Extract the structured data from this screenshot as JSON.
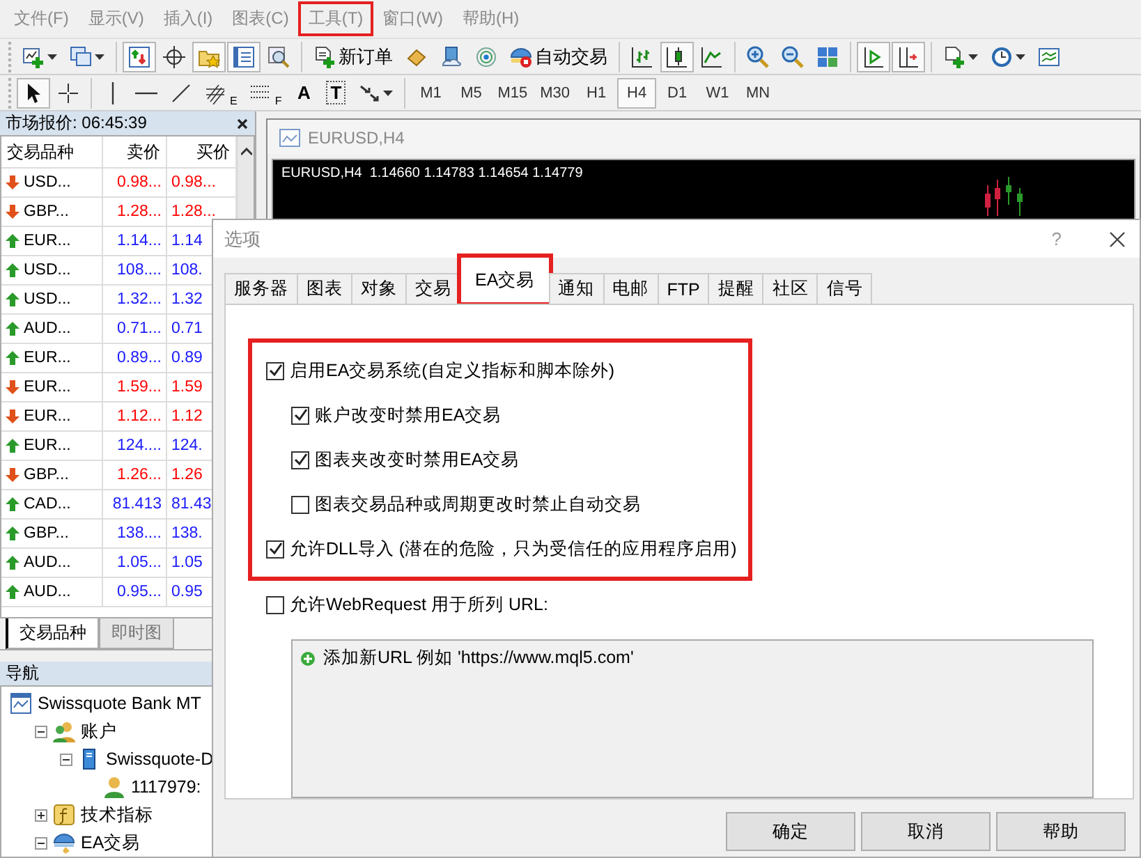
{
  "menu": [
    {
      "label": "文件(F)",
      "highlighted": false
    },
    {
      "label": "显示(V)",
      "highlighted": false
    },
    {
      "label": "插入(I)",
      "highlighted": false
    },
    {
      "label": "图表(C)",
      "highlighted": false
    },
    {
      "label": "工具(T)",
      "highlighted": true
    },
    {
      "label": "窗口(W)",
      "highlighted": false
    },
    {
      "label": "帮助(H)",
      "highlighted": false
    }
  ],
  "toolbar_main": [
    {
      "buttons": [
        {
          "kind": "newchart",
          "pressed": false,
          "dropdown": true
        },
        {
          "kind": "profiles",
          "pressed": false,
          "dropdown": true
        }
      ]
    },
    {
      "buttons": [
        {
          "kind": "marketwatch",
          "pressed": true
        },
        {
          "kind": "datawindow",
          "pressed": false
        },
        {
          "kind": "favorites",
          "pressed": true
        },
        {
          "kind": "navigator",
          "pressed": true
        },
        {
          "kind": "tester",
          "pressed": false
        }
      ]
    },
    {
      "buttons": [
        {
          "kind": "neworder",
          "pressed": false,
          "label": "新订单"
        },
        {
          "kind": "editor",
          "pressed": false
        },
        {
          "kind": "cloud",
          "pressed": false
        },
        {
          "kind": "signals",
          "pressed": false
        },
        {
          "kind": "autotrade",
          "pressed": false,
          "label": "自动交易"
        }
      ]
    },
    {
      "buttons": [
        {
          "kind": "bars",
          "pressed": false
        },
        {
          "kind": "candles",
          "pressed": true
        },
        {
          "kind": "line",
          "pressed": false
        }
      ]
    },
    {
      "buttons": [
        {
          "kind": "zoomin",
          "pressed": false
        },
        {
          "kind": "zoomout",
          "pressed": false
        },
        {
          "kind": "tile",
          "pressed": false
        }
      ]
    },
    {
      "buttons": [
        {
          "kind": "autoscroll",
          "pressed": true
        },
        {
          "kind": "shift",
          "pressed": true
        }
      ]
    },
    {
      "buttons": [
        {
          "kind": "template",
          "pressed": false,
          "dropdown": true
        },
        {
          "kind": "clock",
          "pressed": false,
          "dropdown": true
        },
        {
          "kind": "indicator",
          "pressed": false
        }
      ]
    }
  ],
  "toolbar_tools": [
    {
      "buttons": [
        {
          "kind": "cursor",
          "pressed": true
        },
        {
          "kind": "cross",
          "pressed": false
        }
      ]
    },
    {
      "buttons": [
        {
          "kind": "vline",
          "pressed": false
        },
        {
          "kind": "hline",
          "pressed": false
        },
        {
          "kind": "trend",
          "pressed": false
        },
        {
          "kind": "fibchannel",
          "pressed": false,
          "sub": "E"
        },
        {
          "kind": "fib",
          "pressed": false,
          "sub": "F"
        },
        {
          "kind": "text",
          "pressed": false,
          "label": "A"
        },
        {
          "kind": "textlabel",
          "pressed": false,
          "label": "T"
        },
        {
          "kind": "arrows",
          "pressed": false,
          "dropdown": true
        }
      ]
    },
    {
      "buttons": [
        {
          "kind": "period",
          "label": "M1",
          "pressed": false
        },
        {
          "kind": "period",
          "label": "M5",
          "pressed": false
        },
        {
          "kind": "period",
          "label": "M15",
          "pressed": false
        },
        {
          "kind": "period",
          "label": "M30",
          "pressed": false
        },
        {
          "kind": "period",
          "label": "H1",
          "pressed": false
        },
        {
          "kind": "period",
          "label": "H4",
          "pressed": true
        },
        {
          "kind": "period",
          "label": "D1",
          "pressed": false
        },
        {
          "kind": "period",
          "label": "W1",
          "pressed": false
        },
        {
          "kind": "period",
          "label": "MN",
          "pressed": false
        }
      ]
    }
  ],
  "market_watch": {
    "title": "市场报价: 06:45:39",
    "columns": [
      "交易品种",
      "卖价",
      "买价"
    ],
    "rows": [
      {
        "symbol": "USD...",
        "bid": "0.98...",
        "ask": "0.98...",
        "up": false
      },
      {
        "symbol": "GBP...",
        "bid": "1.28...",
        "ask": "1.28...",
        "up": false
      },
      {
        "symbol": "EUR...",
        "bid": "1.14...",
        "ask": "1.14",
        "up": true
      },
      {
        "symbol": "USD...",
        "bid": "108....",
        "ask": "108.",
        "up": true
      },
      {
        "symbol": "USD...",
        "bid": "1.32...",
        "ask": "1.32",
        "up": true
      },
      {
        "symbol": "AUD...",
        "bid": "0.71...",
        "ask": "0.71",
        "up": true
      },
      {
        "symbol": "EUR...",
        "bid": "0.89...",
        "ask": "0.89",
        "up": true
      },
      {
        "symbol": "EUR...",
        "bid": "1.59...",
        "ask": "1.59",
        "up": false
      },
      {
        "symbol": "EUR...",
        "bid": "1.12...",
        "ask": "1.12",
        "up": false
      },
      {
        "symbol": "EUR...",
        "bid": "124....",
        "ask": "124.",
        "up": true
      },
      {
        "symbol": "GBP...",
        "bid": "1.26...",
        "ask": "1.26",
        "up": false
      },
      {
        "symbol": "CAD...",
        "bid": "81.413",
        "ask": "81.43",
        "up": true
      },
      {
        "symbol": "GBP...",
        "bid": "138....",
        "ask": "138.",
        "up": true
      },
      {
        "symbol": "AUD...",
        "bid": "1.05...",
        "ask": "1.05",
        "up": true
      },
      {
        "symbol": "AUD...",
        "bid": "0.95...",
        "ask": "0.95",
        "up": true
      }
    ],
    "tabs": [
      {
        "label": "交易品种",
        "selected": true
      },
      {
        "label": "即时图",
        "selected": false
      }
    ]
  },
  "navigator": {
    "title": "导航",
    "tree": [
      {
        "label": "Swissquote Bank MT",
        "kind": "terminal",
        "children": [
          {
            "label": "账户",
            "kind": "accounts",
            "expanded": true,
            "children": [
              {
                "label": "Swissquote-D",
                "kind": "server",
                "expanded": true,
                "children": [
                  {
                    "label": "1117979:",
                    "kind": "account"
                  }
                ]
              }
            ]
          },
          {
            "label": "技术指标",
            "kind": "indicators",
            "expanded": false
          },
          {
            "label": "EA交易",
            "kind": "experts",
            "expanded": true
          }
        ]
      }
    ]
  },
  "chart": {
    "title": "EURUSD,H4",
    "info": "EURUSD,H4  1.14660 1.14783 1.14654 1.14779"
  },
  "dialog": {
    "title": "选项",
    "help": "?",
    "tabs": [
      {
        "label": "服务器",
        "selected": false,
        "highlighted": false
      },
      {
        "label": "图表",
        "selected": false,
        "highlighted": false
      },
      {
        "label": "对象",
        "selected": false,
        "highlighted": false
      },
      {
        "label": "交易",
        "selected": false,
        "highlighted": false
      },
      {
        "label": "EA交易",
        "selected": true,
        "highlighted": true
      },
      {
        "label": "通知",
        "selected": false,
        "highlighted": false
      },
      {
        "label": "电邮",
        "selected": false,
        "highlighted": false
      },
      {
        "label": "FTP",
        "selected": false,
        "highlighted": false
      },
      {
        "label": "提醒",
        "selected": false,
        "highlighted": false
      },
      {
        "label": "社区",
        "selected": false,
        "highlighted": false
      },
      {
        "label": "信号",
        "selected": false,
        "highlighted": false
      }
    ],
    "option_groups": [
      {
        "highlighted": true,
        "options": [
          {
            "label": "启用EA交易系统(自定义指标和脚本除外)",
            "checked": true,
            "children": [
              {
                "label": "账户改变时禁用EA交易",
                "checked": true
              },
              {
                "label": "图表夹改变时禁用EA交易",
                "checked": true
              },
              {
                "label": "图表交易品种或周期更改时禁止自动交易",
                "checked": false
              }
            ]
          },
          {
            "label": "允许DLL导入 (潜在的危险，只为受信任的应用程序启用)",
            "checked": true
          }
        ]
      },
      {
        "highlighted": false,
        "options": [
          {
            "label": "允许WebRequest 用于所列 URL:",
            "checked": false
          }
        ]
      }
    ],
    "url_list": [
      {
        "label": "添加新URL 例如 'https://www.mql5.com'"
      }
    ],
    "buttons": [
      "确定",
      "取消",
      "帮助"
    ]
  }
}
